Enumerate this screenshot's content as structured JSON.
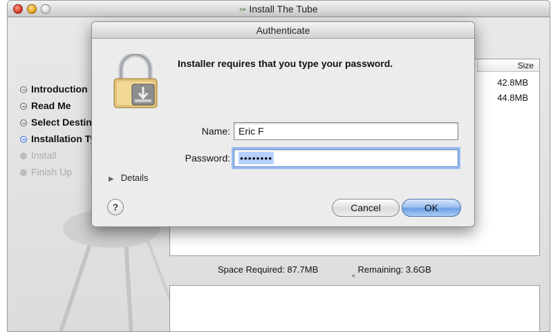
{
  "installer": {
    "title": "Install The Tube",
    "steps": [
      {
        "label": "Introduction",
        "state": "done"
      },
      {
        "label": "Read Me",
        "state": "done"
      },
      {
        "label": "Select Destination",
        "state": "done"
      },
      {
        "label": "Installation Type",
        "state": "current"
      },
      {
        "label": "Install",
        "state": "future"
      },
      {
        "label": "Finish Up",
        "state": "future"
      }
    ],
    "size_header": "Size",
    "sizes": [
      "42.8MB",
      "44.8MB"
    ],
    "space_required_label": "Space Required:",
    "space_required_value": "87.7MB",
    "remaining_label": "Remaining:",
    "remaining_value": "3.6GB"
  },
  "auth": {
    "title": "Authenticate",
    "prompt": "Installer requires that you type your password.",
    "name_label": "Name:",
    "name_value": "Eric F",
    "password_label": "Password:",
    "password_masked": "••••••••",
    "details_label": "Details",
    "help_label": "?",
    "cancel_label": "Cancel",
    "ok_label": "OK"
  },
  "icons": {
    "window_controls": [
      "close-icon",
      "minimize-icon",
      "zoom-icon"
    ],
    "title_icon": "package-icon",
    "dialog_icon": "lock-icon",
    "disclosure": "disclosure-triangle-icon"
  },
  "colors": {
    "accent_blue": "#6f9fe2",
    "focus_ring": "#9cbcf0",
    "close": "#d53b2a",
    "minimize": "#e8a31a"
  }
}
